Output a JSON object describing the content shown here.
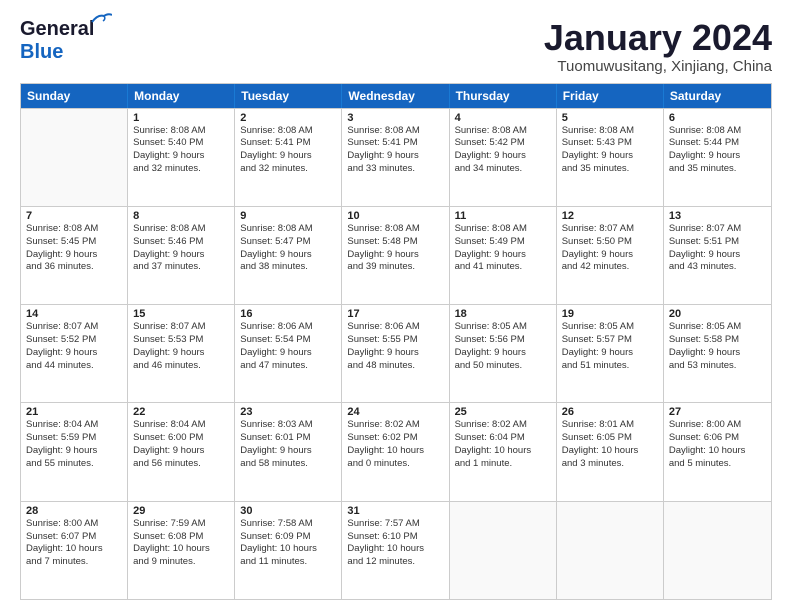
{
  "header": {
    "logo_line1": "General",
    "logo_line2": "Blue",
    "month": "January 2024",
    "location": "Tuomuwusitang, Xinjiang, China"
  },
  "weekdays": [
    "Sunday",
    "Monday",
    "Tuesday",
    "Wednesday",
    "Thursday",
    "Friday",
    "Saturday"
  ],
  "rows": [
    [
      {
        "day": "",
        "text": ""
      },
      {
        "day": "1",
        "text": "Sunrise: 8:08 AM\nSunset: 5:40 PM\nDaylight: 9 hours\nand 32 minutes."
      },
      {
        "day": "2",
        "text": "Sunrise: 8:08 AM\nSunset: 5:41 PM\nDaylight: 9 hours\nand 32 minutes."
      },
      {
        "day": "3",
        "text": "Sunrise: 8:08 AM\nSunset: 5:41 PM\nDaylight: 9 hours\nand 33 minutes."
      },
      {
        "day": "4",
        "text": "Sunrise: 8:08 AM\nSunset: 5:42 PM\nDaylight: 9 hours\nand 34 minutes."
      },
      {
        "day": "5",
        "text": "Sunrise: 8:08 AM\nSunset: 5:43 PM\nDaylight: 9 hours\nand 35 minutes."
      },
      {
        "day": "6",
        "text": "Sunrise: 8:08 AM\nSunset: 5:44 PM\nDaylight: 9 hours\nand 35 minutes."
      }
    ],
    [
      {
        "day": "7",
        "text": "Sunrise: 8:08 AM\nSunset: 5:45 PM\nDaylight: 9 hours\nand 36 minutes."
      },
      {
        "day": "8",
        "text": "Sunrise: 8:08 AM\nSunset: 5:46 PM\nDaylight: 9 hours\nand 37 minutes."
      },
      {
        "day": "9",
        "text": "Sunrise: 8:08 AM\nSunset: 5:47 PM\nDaylight: 9 hours\nand 38 minutes."
      },
      {
        "day": "10",
        "text": "Sunrise: 8:08 AM\nSunset: 5:48 PM\nDaylight: 9 hours\nand 39 minutes."
      },
      {
        "day": "11",
        "text": "Sunrise: 8:08 AM\nSunset: 5:49 PM\nDaylight: 9 hours\nand 41 minutes."
      },
      {
        "day": "12",
        "text": "Sunrise: 8:07 AM\nSunset: 5:50 PM\nDaylight: 9 hours\nand 42 minutes."
      },
      {
        "day": "13",
        "text": "Sunrise: 8:07 AM\nSunset: 5:51 PM\nDaylight: 9 hours\nand 43 minutes."
      }
    ],
    [
      {
        "day": "14",
        "text": "Sunrise: 8:07 AM\nSunset: 5:52 PM\nDaylight: 9 hours\nand 44 minutes."
      },
      {
        "day": "15",
        "text": "Sunrise: 8:07 AM\nSunset: 5:53 PM\nDaylight: 9 hours\nand 46 minutes."
      },
      {
        "day": "16",
        "text": "Sunrise: 8:06 AM\nSunset: 5:54 PM\nDaylight: 9 hours\nand 47 minutes."
      },
      {
        "day": "17",
        "text": "Sunrise: 8:06 AM\nSunset: 5:55 PM\nDaylight: 9 hours\nand 48 minutes."
      },
      {
        "day": "18",
        "text": "Sunrise: 8:05 AM\nSunset: 5:56 PM\nDaylight: 9 hours\nand 50 minutes."
      },
      {
        "day": "19",
        "text": "Sunrise: 8:05 AM\nSunset: 5:57 PM\nDaylight: 9 hours\nand 51 minutes."
      },
      {
        "day": "20",
        "text": "Sunrise: 8:05 AM\nSunset: 5:58 PM\nDaylight: 9 hours\nand 53 minutes."
      }
    ],
    [
      {
        "day": "21",
        "text": "Sunrise: 8:04 AM\nSunset: 5:59 PM\nDaylight: 9 hours\nand 55 minutes."
      },
      {
        "day": "22",
        "text": "Sunrise: 8:04 AM\nSunset: 6:00 PM\nDaylight: 9 hours\nand 56 minutes."
      },
      {
        "day": "23",
        "text": "Sunrise: 8:03 AM\nSunset: 6:01 PM\nDaylight: 9 hours\nand 58 minutes."
      },
      {
        "day": "24",
        "text": "Sunrise: 8:02 AM\nSunset: 6:02 PM\nDaylight: 10 hours\nand 0 minutes."
      },
      {
        "day": "25",
        "text": "Sunrise: 8:02 AM\nSunset: 6:04 PM\nDaylight: 10 hours\nand 1 minute."
      },
      {
        "day": "26",
        "text": "Sunrise: 8:01 AM\nSunset: 6:05 PM\nDaylight: 10 hours\nand 3 minutes."
      },
      {
        "day": "27",
        "text": "Sunrise: 8:00 AM\nSunset: 6:06 PM\nDaylight: 10 hours\nand 5 minutes."
      }
    ],
    [
      {
        "day": "28",
        "text": "Sunrise: 8:00 AM\nSunset: 6:07 PM\nDaylight: 10 hours\nand 7 minutes."
      },
      {
        "day": "29",
        "text": "Sunrise: 7:59 AM\nSunset: 6:08 PM\nDaylight: 10 hours\nand 9 minutes."
      },
      {
        "day": "30",
        "text": "Sunrise: 7:58 AM\nSunset: 6:09 PM\nDaylight: 10 hours\nand 11 minutes."
      },
      {
        "day": "31",
        "text": "Sunrise: 7:57 AM\nSunset: 6:10 PM\nDaylight: 10 hours\nand 12 minutes."
      },
      {
        "day": "",
        "text": ""
      },
      {
        "day": "",
        "text": ""
      },
      {
        "day": "",
        "text": ""
      }
    ]
  ]
}
